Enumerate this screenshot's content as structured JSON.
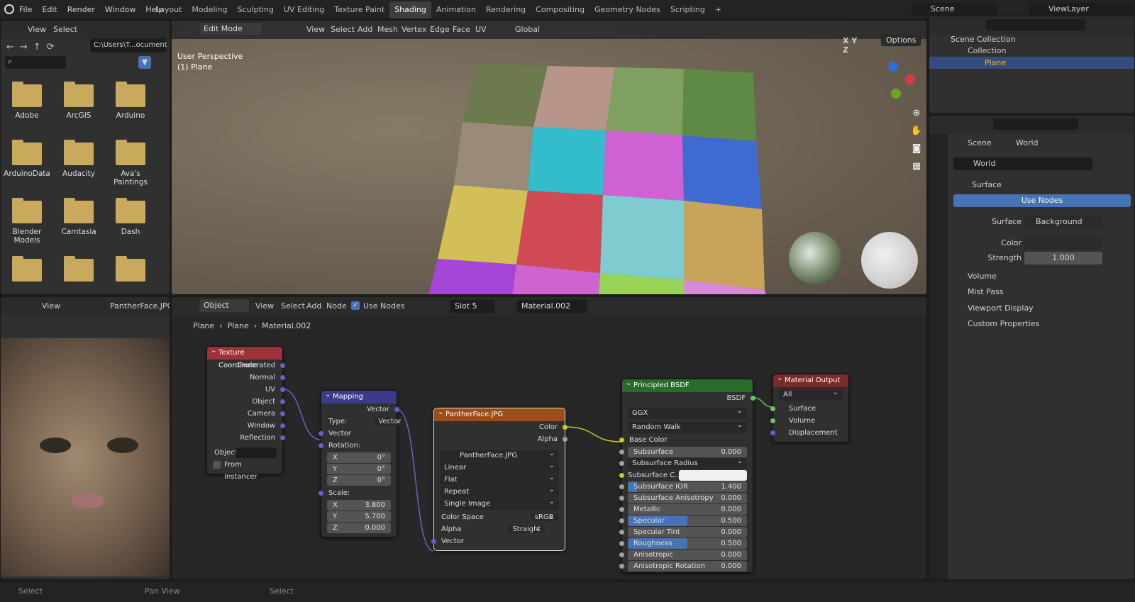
{
  "menu": [
    "File",
    "Edit",
    "Render",
    "Window",
    "Help"
  ],
  "workspaces": [
    "Layout",
    "Modeling",
    "Sculpting",
    "UV Editing",
    "Texture Paint",
    "Shading",
    "Animation",
    "Rendering",
    "Compositing",
    "Geometry Nodes",
    "Scripting",
    "+"
  ],
  "active_workspace": "Shading",
  "scene": "Scene",
  "viewlayer": "ViewLayer",
  "filebrowser": {
    "view": "View",
    "select": "Select",
    "path": "C:\\Users\\T...ocuments\\",
    "folders": [
      "Adobe",
      "ArcGIS",
      "Arduino",
      "ArduinoData",
      "Audacity",
      "Ava's Paintings",
      "Blender Models",
      "Camtasia",
      "Dash",
      "",
      "",
      ""
    ]
  },
  "viewport": {
    "mode": "Edit Mode",
    "menus": [
      "View",
      "Select",
      "Add",
      "Mesh",
      "Vertex",
      "Edge",
      "Face",
      "UV"
    ],
    "transform": "Global",
    "info1": "User Perspective",
    "info2": "(1) Plane",
    "options": "Options",
    "axes": [
      "X",
      "Y",
      "Z"
    ]
  },
  "image_editor": {
    "view": "View",
    "image": "PantherFace.JPG"
  },
  "node_editor": {
    "object": "Object",
    "menus": [
      "View",
      "Select",
      "Add",
      "Node"
    ],
    "use_nodes": "Use Nodes",
    "slot": "Slot 5",
    "material": "Material.002",
    "breadcrumb": [
      "Plane",
      "Plane",
      "Material.002"
    ]
  },
  "nodes": {
    "texcoord": {
      "title": "Texture Coordinate",
      "outputs": [
        "Generated",
        "Normal",
        "UV",
        "Object",
        "Camera",
        "Window",
        "Reflection"
      ],
      "object_label": "Object:",
      "from_instancer": "From Instancer"
    },
    "mapping": {
      "title": "Mapping",
      "out": "Vector",
      "type_label": "Type:",
      "type": "Vector",
      "vector": "Vector",
      "rotation": "Rotation:",
      "rot": [
        [
          "X",
          "0°"
        ],
        [
          "Y",
          "0°"
        ],
        [
          "Z",
          "0°"
        ]
      ],
      "scale": "Scale:",
      "sc": [
        [
          "X",
          "3.800"
        ],
        [
          "Y",
          "5.700"
        ],
        [
          "Z",
          "0.000"
        ]
      ]
    },
    "image": {
      "title": "PantherFace.JPG",
      "color": "Color",
      "alpha": "Alpha",
      "file": "PantherFace.JPG",
      "interp": "Linear",
      "proj": "Flat",
      "ext": "Repeat",
      "source": "Single Image",
      "cs_label": "Color Space",
      "cs": "sRGB",
      "alpha_label": "Alpha",
      "alpha_mode": "Straight",
      "vector": "Vector"
    },
    "bsdf": {
      "title": "Principled BSDF",
      "out": "BSDF",
      "dist": "GGX",
      "sss": "Random Walk",
      "base": "Base Color",
      "rows": [
        [
          "Subsurface",
          "0.000"
        ],
        [
          "Subsurface Radius",
          ""
        ],
        [
          "Subsurface C...",
          ""
        ],
        [
          "Subsurface IOR",
          "1.400"
        ],
        [
          "Subsurface Anisotropy",
          "0.000"
        ],
        [
          "Metallic",
          "0.000"
        ],
        [
          "Specular",
          "0.500"
        ],
        [
          "Specular Tint",
          "0.000"
        ],
        [
          "Roughness",
          "0.500"
        ],
        [
          "Anisotropic",
          "0.000"
        ],
        [
          "Anisotropic Rotation",
          "0.000"
        ]
      ]
    },
    "output": {
      "title": "Material Output",
      "target": "All",
      "inputs": [
        "Surface",
        "Volume",
        "Displacement"
      ]
    }
  },
  "outliner": {
    "root": "Scene Collection",
    "collection": "Collection",
    "plane": "Plane"
  },
  "properties": {
    "crumb": [
      "Scene",
      "World"
    ],
    "world": "World",
    "surface": "Surface",
    "use_nodes": "Use Nodes",
    "surface_label": "Surface",
    "surface_val": "Background",
    "color": "Color",
    "strength": "Strength",
    "strength_val": "1.000",
    "sections": [
      "Volume",
      "Mist Pass",
      "Viewport Display",
      "Custom Properties"
    ]
  },
  "status": [
    "Select",
    "Pan View",
    "Select"
  ],
  "colors": {
    "accent": "#4772b3",
    "texcoord": "#a0303a",
    "mapping": "#3e3a8a",
    "image": "#9a4f1a",
    "bsdf": "#2a6a2a",
    "output": "#7a2a2a"
  }
}
